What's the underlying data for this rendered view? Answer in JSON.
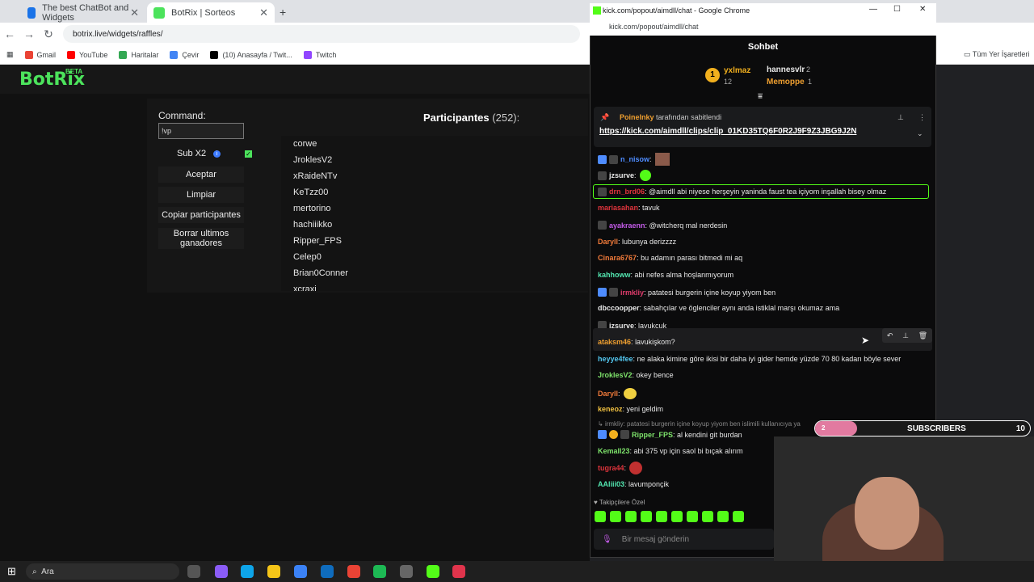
{
  "browser": {
    "tabs": [
      {
        "title": "The best ChatBot and Widgets"
      },
      {
        "title": "BotRix | Sorteos"
      }
    ],
    "url": "botrix.live/widgets/raffles/",
    "bookmarks": [
      "Gmail",
      "YouTube",
      "Haritalar",
      "Çevir",
      "(10) Anasayfa / Twit...",
      "Twitch"
    ],
    "all_bookmarks": "Tüm Yer İşaretleri"
  },
  "botrix": {
    "logo": "BotRix",
    "beta": "BETA",
    "command_label": "Command:",
    "command_value": "!vp",
    "sub_label": "Sub X2",
    "sub_checked": true,
    "buttons": [
      "Aceptar",
      "Limpiar",
      "Copiar participantes",
      "Borrar ultimos ganadores"
    ],
    "participants_title": "Participantes",
    "participants_count": "(252):",
    "participants": [
      "corwe",
      "JroklesV2",
      "xRaideNTv",
      "KeTzz00",
      "mertorino",
      "hachiiikko",
      "Ripper_FPS",
      "Celep0",
      "Brian0Conner",
      "xcraxi"
    ]
  },
  "popup": {
    "window_title": "kick.com/popout/aimdll/chat - Google Chrome",
    "url": "kick.com/popout/aimdll/chat",
    "chat_title": "Sohbet",
    "leaders": [
      {
        "rank": "1",
        "name": "yxlmaz",
        "count": "12"
      },
      {
        "name": "hannesvlr",
        "count": "2"
      },
      {
        "name": "Memoppe",
        "count": "1"
      }
    ],
    "pinned_by": "Poinelnky",
    "pinned_suffix": "tarafından sabitlendi",
    "pinned_link": "https://kick.com/aimdll/clips/clip_01KD35TQ6F0R2J9F9Z3JBG9J2N",
    "messages": [
      {
        "user": "n_nisow",
        "text": "",
        "color": "#4e8cff"
      },
      {
        "user": "jzsurve",
        "text": "",
        "color": "#e8e8e8"
      },
      {
        "user": "drn_brd06",
        "text": "@aimdll abi niyese herşeyin yaninda faust tea içiyom inşallah bisey olmaz",
        "color": "#e0343c"
      },
      {
        "user": "mariasahan",
        "text": "tavuk",
        "color": "#e0343c"
      },
      {
        "user": "ayakraenn",
        "text": "@witcherq mal nerdesin",
        "color": "#c35be8"
      },
      {
        "user": "Daryll",
        "text": "lubunya derizzzz",
        "color": "#f07a3a"
      },
      {
        "user": "Cinara6767",
        "text": "bu adamın parası bitmedi mi aq",
        "color": "#f07a3a"
      },
      {
        "user": "kahhoww",
        "text": "abi nefes alma hoşlanmıyorum",
        "color": "#53e6b0"
      },
      {
        "user": "irmkliy",
        "text": "patatesi burgerin içine koyup yiyom ben",
        "color": "#e03c6c"
      },
      {
        "user": "dbccoopper",
        "text": "sabahçılar ve öglenciler aynı anda istiklal marşı okumaz ama",
        "color": "#e8e8e8"
      },
      {
        "user": "jzsurve",
        "text": "lavukcuk",
        "color": "#e8e8e8"
      },
      {
        "user": "ataksm46",
        "text": "lavukişkom?",
        "color": "#f0a030"
      },
      {
        "user": "heyye4fee",
        "text": "ne alaka kimine göre ikisi bir daha iyi gider hemde yüzde 70 80 kadarı böyle sever",
        "color": "#53c7f0"
      },
      {
        "user": "JroklesV2",
        "text": "okey bence",
        "color": "#7ee36b"
      },
      {
        "user": "Daryll",
        "text": "",
        "color": "#f07a3a"
      },
      {
        "user": "keneoz",
        "text": "yeni geldim",
        "color": "#f0c040"
      },
      {
        "user": "Ripper_FPS",
        "text": "al kendini git burdan",
        "color": "#7ee36b"
      },
      {
        "user": "Kemall23",
        "text": "abi 375 vp için saol bi bıçak alırım",
        "color": "#7ee36b"
      },
      {
        "user": "tugra44",
        "text": "",
        "color": "#e0343c"
      },
      {
        "user": "AAliii03",
        "text": "lavumponçik",
        "color": "#53e6b0"
      }
    ],
    "reply_context": "irmkliy: patatesi burgerin içine koyup yiyom ben islimili kullanıcıya ya",
    "followers_only": "Takipçilere Özel",
    "input_placeholder": "Bir mesaj gönderin"
  },
  "overlay": {
    "subs_label": "SUBSCRIBERS",
    "subs_value": "10",
    "subs_progress": "2"
  },
  "taskbar": {
    "search": "Ara"
  }
}
